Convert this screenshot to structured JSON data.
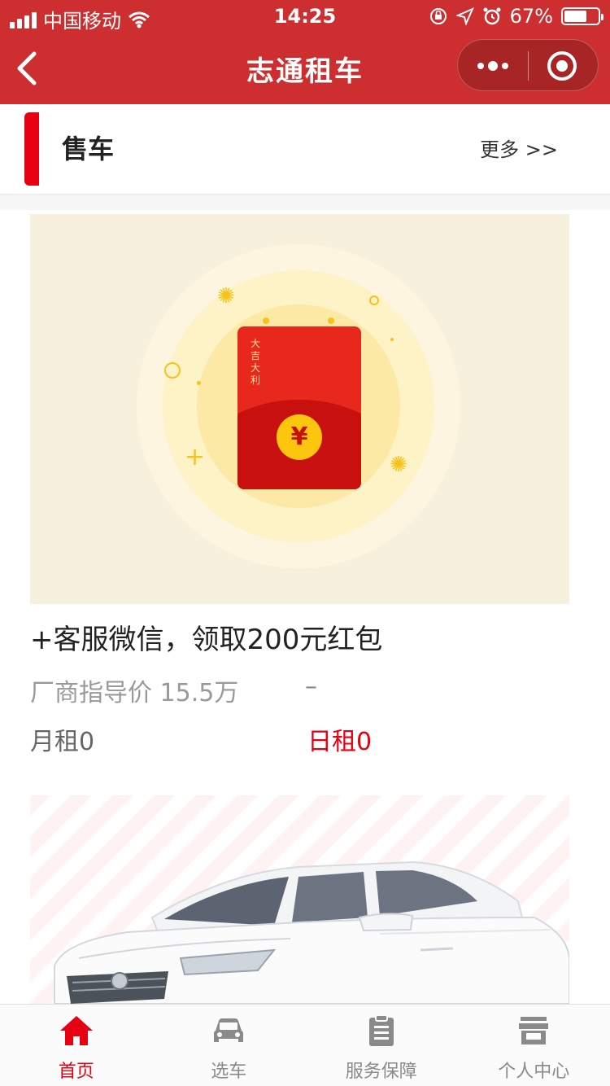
{
  "status_bar": {
    "carrier": "中国移动",
    "time": "14:25",
    "battery_percent": "67%",
    "battery_level": 0.67
  },
  "nav": {
    "title": "志通租车",
    "accent_color": "#cd2e2f"
  },
  "section": {
    "title": "售车",
    "more": "更多 >>"
  },
  "card1": {
    "title": "+客服微信，领取200元红包",
    "price_label": "厂商指导价 15.5万",
    "price_dash": "–",
    "monthly": "月租0",
    "daily": "日租0",
    "envelope_text": "大吉大利",
    "coin": "¥"
  },
  "tabs": [
    {
      "label": "首页",
      "icon": "home-icon",
      "active": true
    },
    {
      "label": "选车",
      "icon": "car-icon",
      "active": false
    },
    {
      "label": "服务保障",
      "icon": "clipboard-icon",
      "active": false
    },
    {
      "label": "个人中心",
      "icon": "store-icon",
      "active": false
    }
  ],
  "colors": {
    "active": "#e60012",
    "inactive": "#8a8a8a"
  }
}
